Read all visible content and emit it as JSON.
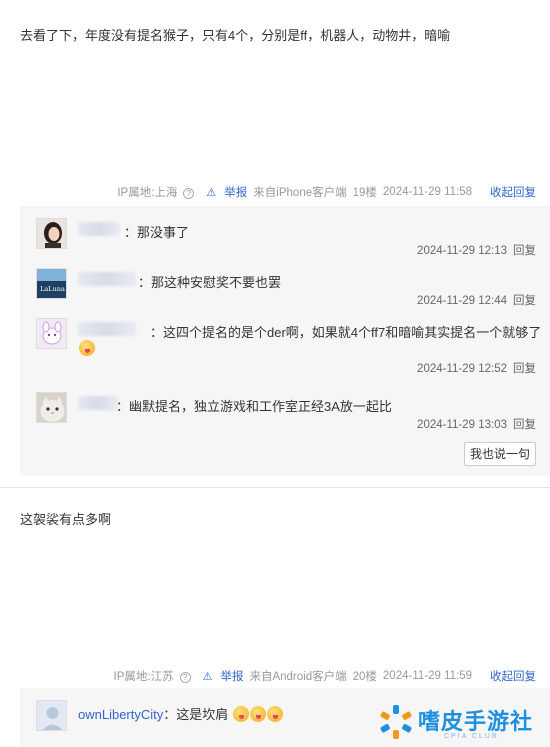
{
  "posts": [
    {
      "text": "去看了下，年度没有提名猴子，只有4个，分别是ff，机器人，动物井，暗喻",
      "meta": {
        "ip": "IP属地:上海",
        "report": "举报",
        "source": "来自iPhone客户端",
        "floor": "19楼",
        "time": "2024-11-29 11:58",
        "collapse": "收起回复"
      },
      "replies": [
        {
          "text": "：那没事了",
          "time": "2024-11-29 12:13",
          "reply": "回复"
        },
        {
          "text": "：那这种安慰奖不要也罢",
          "time": "2024-11-29 12:44",
          "reply": "回复",
          "avatar_label": "LaLuna"
        },
        {
          "text": "：这四个提名的是个der啊，如果就4个ff7和暗喻其实提名一个就够了",
          "time": "2024-11-29 12:52",
          "reply": "回复"
        },
        {
          "text": "：幽默提名，独立游戏和工作室正经3A放一起比",
          "time": "2024-11-29 13:03",
          "reply": "回复"
        }
      ],
      "say_button": "我也说一句"
    },
    {
      "text": "这袈裟有点多啊",
      "meta": {
        "ip": "IP属地:江苏",
        "report": "举报",
        "source": "来自Android客户端",
        "floor": "20楼",
        "time": "2024-11-29 11:59",
        "collapse": "收起回复"
      },
      "replies": [
        {
          "user": "ownLibertyCity",
          "text": "：这是坎肩"
        }
      ]
    }
  ],
  "watermark": {
    "title": "嗜皮手游社",
    "subtitle": "CPIA CLUB"
  },
  "colors": {
    "link": "#3366cc",
    "meta": "#999999",
    "reply_bg": "#f6f6f6",
    "brand": "#1f8fe0"
  }
}
